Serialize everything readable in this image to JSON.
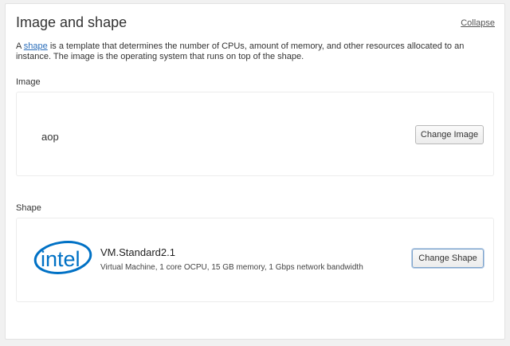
{
  "section": {
    "title": "Image and shape",
    "collapse_label": "Collapse",
    "description_prefix": "A ",
    "description_link": "shape",
    "description_suffix": " is a template that determines the number of CPUs, amount of memory, and other resources allocated to an instance. The image is the operating system that runs on top of the shape."
  },
  "image": {
    "label": "Image",
    "name": "aop",
    "change_button": "Change Image"
  },
  "shape": {
    "label": "Shape",
    "logo_text": "intel",
    "name": "VM.Standard2.1",
    "details": "Virtual Machine, 1 core OCPU, 15 GB memory, 1 Gbps network bandwidth",
    "change_button": "Change Shape"
  },
  "colors": {
    "link": "#2a6ebb",
    "intel_blue": "#0071c5",
    "focus_border": "#7ea4cc"
  }
}
